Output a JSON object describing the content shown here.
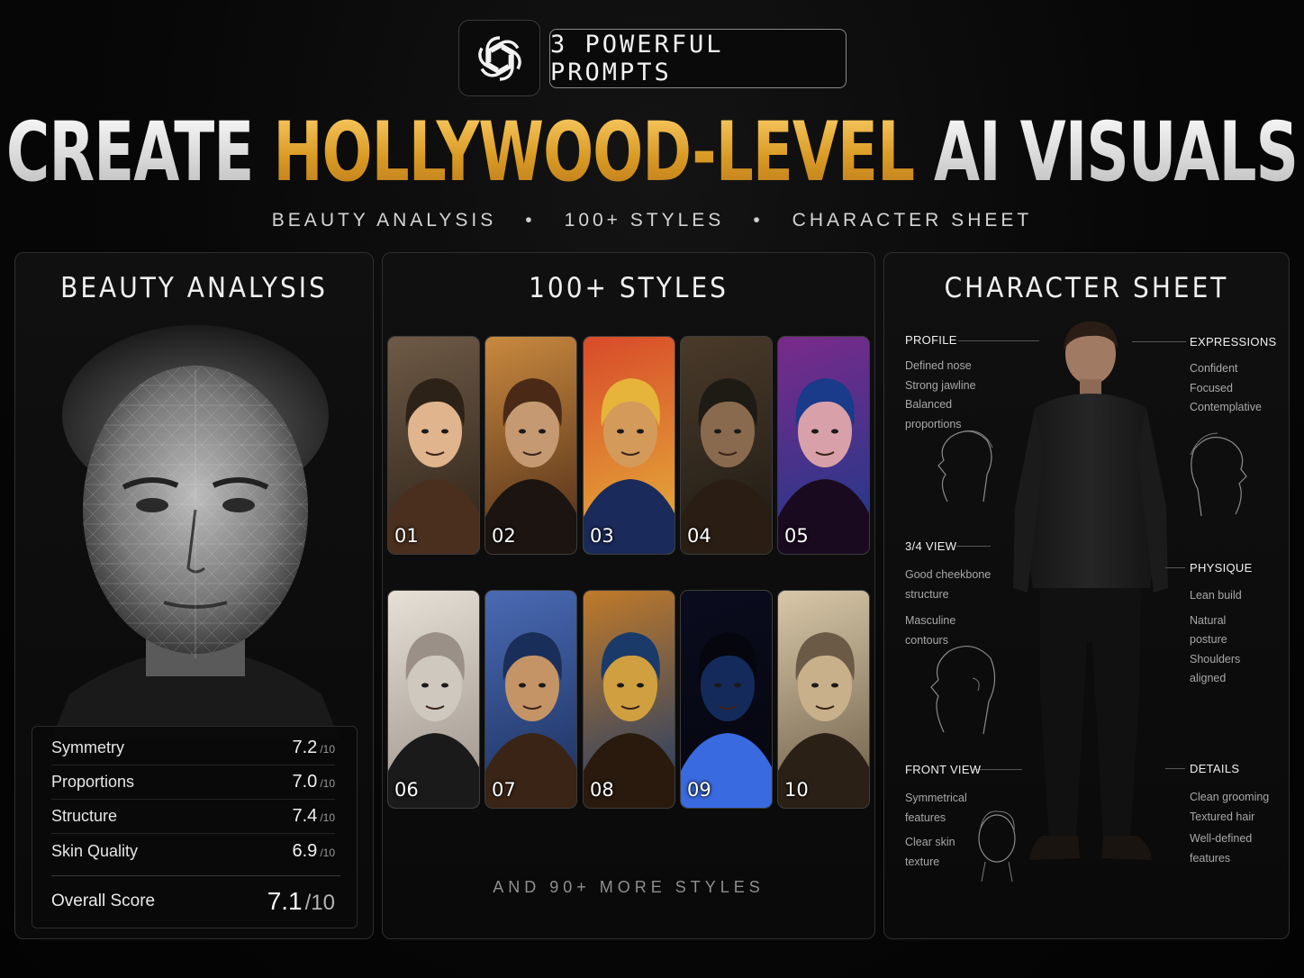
{
  "header": {
    "badge": "3 POWERFUL PROMPTS",
    "title_part1": "CREATE",
    "title_part2": "HOLLYWOOD-LEVEL",
    "title_part3": "AI VISUALS",
    "subtitle_items": [
      "BEAUTY ANALYSIS",
      "100+ STYLES",
      "CHARACTER SHEET"
    ],
    "logo_icon": "openai-logo-icon"
  },
  "beauty": {
    "title": "BEAUTY ANALYSIS",
    "scores": [
      {
        "label": "Symmetry",
        "value": "7.2",
        "max": "/10"
      },
      {
        "label": "Proportions",
        "value": "7.0",
        "max": "/10"
      },
      {
        "label": "Structure",
        "value": "7.4",
        "max": "/10"
      },
      {
        "label": "Skin Quality",
        "value": "6.9",
        "max": "/10"
      }
    ],
    "overall_label": "Overall Score",
    "overall_value": "7.1",
    "overall_max": "/10"
  },
  "styles": {
    "title": "100+ STYLES",
    "cards": [
      "01",
      "02",
      "03",
      "04",
      "05",
      "06",
      "07",
      "08",
      "09",
      "10"
    ],
    "more": "AND 90+ MORE STYLES"
  },
  "sheet": {
    "title": "CHARACTER SHEET",
    "profile": {
      "label": "PROFILE",
      "notes": [
        "Defined nose",
        "Strong jawline",
        "Balanced",
        "proportions"
      ]
    },
    "three_quarter": {
      "label": "3/4 VIEW",
      "notes": [
        "Good cheekbone",
        "structure",
        "Masculine",
        "contours"
      ]
    },
    "front": {
      "label": "FRONT VIEW",
      "notes": [
        "Symmetrical",
        "features",
        "Clear skin",
        "texture"
      ]
    },
    "expressions": {
      "label": "EXPRESSIONS",
      "notes": [
        "Confident",
        "Focused",
        "Contemplative"
      ]
    },
    "physique": {
      "label": "PHYSIQUE",
      "notes": [
        "Lean build",
        "Natural",
        "posture",
        "Shoulders",
        "aligned"
      ]
    },
    "details": {
      "label": "DETAILS",
      "notes": [
        "Clean grooming",
        "Textured hair",
        "Well-defined",
        "features"
      ]
    }
  }
}
